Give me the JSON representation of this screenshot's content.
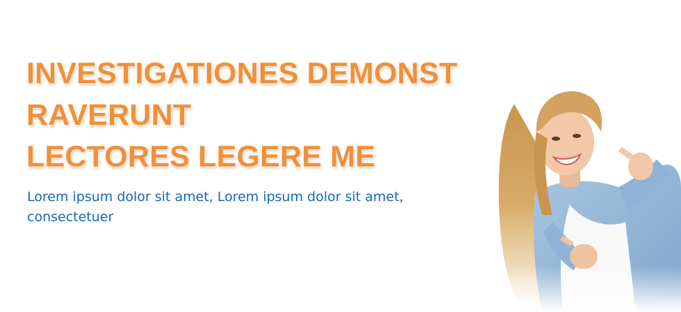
{
  "hero": {
    "headline_lines": [
      "INVESTIGATIONES DEMONST",
      "RAVERUNT",
      "LECTORES LEGERE ME"
    ],
    "subtext_lines": [
      "Lorem ipsum dolor sit amet, Lorem ipsum dolor sit amet,",
      "consectetuer"
    ],
    "colors": {
      "headline": "#f0903a",
      "subtext": "#1565b8",
      "background": "#ffffff"
    }
  }
}
